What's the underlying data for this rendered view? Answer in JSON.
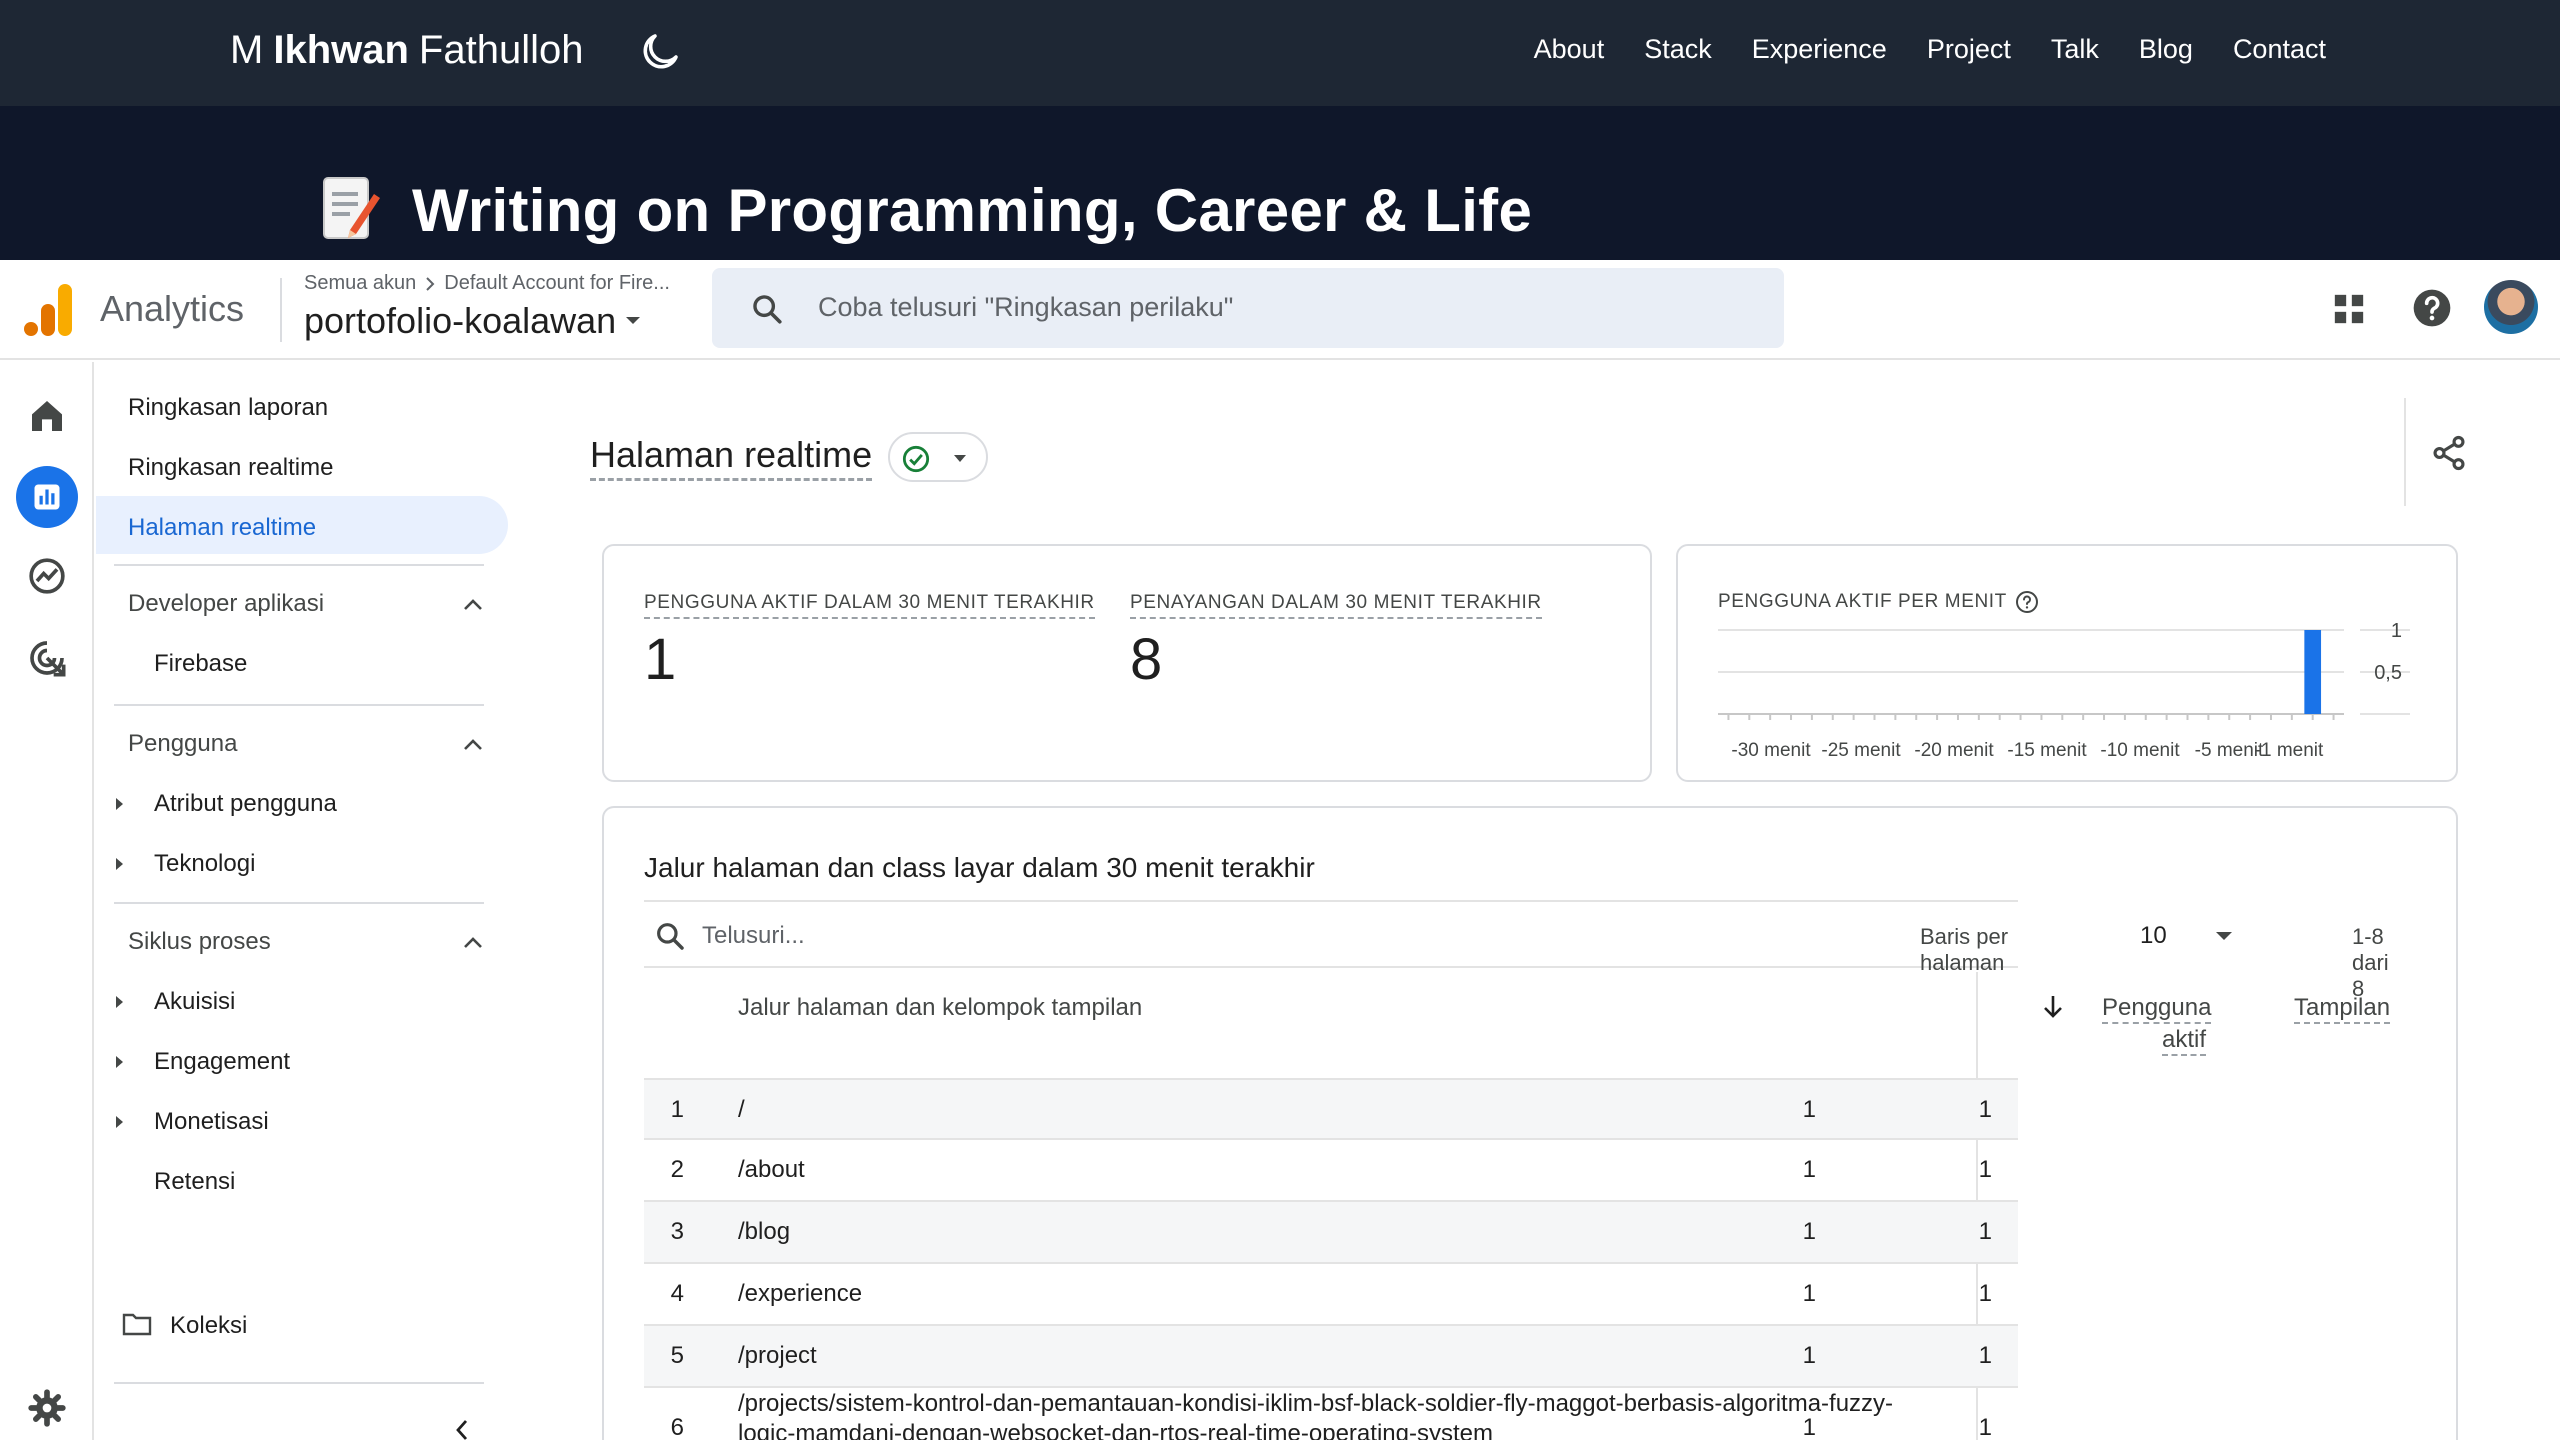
{
  "site": {
    "brand": {
      "first": "M",
      "bold": "Ikhwan",
      "last": "Fathulloh"
    },
    "menu": [
      "About",
      "Stack",
      "Experience",
      "Project",
      "Talk",
      "Blog",
      "Contact"
    ],
    "hero_title": "Writing on Programming, Career & Life"
  },
  "ga": {
    "app_name": "Analytics",
    "breadcrumb_root": "Semua akun",
    "breadcrumb_account": "Default Account for Fire...",
    "property": "portofolio-koalawan",
    "search_placeholder": "Coba telusuri \"Ringkasan perilaku\""
  },
  "nav": {
    "top_items": [
      "Ringkasan laporan",
      "Ringkasan realtime",
      "Halaman realtime"
    ],
    "sections": [
      {
        "title": "Developer aplikasi",
        "items": [
          "Firebase"
        ]
      },
      {
        "title": "Pengguna",
        "items": [
          "Atribut pengguna",
          "Teknologi"
        ]
      },
      {
        "title": "Siklus proses",
        "items": [
          "Akuisisi",
          "Engagement",
          "Monetisasi",
          "Retensi"
        ]
      }
    ],
    "collections": "Koleksi"
  },
  "page": {
    "title": "Halaman realtime",
    "kpi": [
      {
        "label": "PENGGUNA AKTIF DALAM 30 MENIT TERAKHIR",
        "value": "1"
      },
      {
        "label": "PENAYANGAN DALAM 30 MENIT TERAKHIR",
        "value": "8"
      }
    ]
  },
  "chart_data": {
    "type": "bar",
    "title": "PENGGUNA AKTIF PER MENIT",
    "x_tick_labels": [
      "-30 menit",
      "-25 menit",
      "-20 menit",
      "-15 menit",
      "-10 menit",
      "-5 menit",
      "-1 menit"
    ],
    "y_tick_labels": [
      "1",
      "0,5"
    ],
    "ylim": [
      0,
      1
    ],
    "x": [
      -30,
      -29,
      -28,
      -27,
      -26,
      -25,
      -24,
      -23,
      -22,
      -21,
      -20,
      -19,
      -18,
      -17,
      -16,
      -15,
      -14,
      -13,
      -12,
      -11,
      -10,
      -9,
      -8,
      -7,
      -6,
      -5,
      -4,
      -3,
      -2,
      -1
    ],
    "values": [
      0,
      0,
      0,
      0,
      0,
      0,
      0,
      0,
      0,
      0,
      0,
      0,
      0,
      0,
      0,
      0,
      0,
      0,
      0,
      0,
      0,
      0,
      0,
      0,
      0,
      0,
      0,
      0,
      1,
      0
    ],
    "bar_color": "#1a73e8"
  },
  "table": {
    "title": "Jalur halaman dan class layar dalam 30 menit terakhir",
    "search_placeholder": "Telusuri...",
    "rows_per_page_label": "Baris per halaman",
    "rows_per_page": "10",
    "range": "1-8 dari 8",
    "columns": {
      "path": "Jalur halaman dan kelompok tampilan",
      "users_line1": "Pengguna",
      "users_line2": "aktif",
      "views": "Tampilan"
    },
    "rows": [
      {
        "idx": "1",
        "path": "/",
        "users": "1",
        "views": "1"
      },
      {
        "idx": "2",
        "path": "/about",
        "users": "1",
        "views": "1"
      },
      {
        "idx": "3",
        "path": "/blog",
        "users": "1",
        "views": "1"
      },
      {
        "idx": "4",
        "path": "/experience",
        "users": "1",
        "views": "1"
      },
      {
        "idx": "5",
        "path": "/project",
        "users": "1",
        "views": "1"
      },
      {
        "idx": "6",
        "path": "/projects/sistem-kontrol-dan-pemantauan-kondisi-iklim-bsf-black-soldier-fly-maggot-berbasis-algoritma-fuzzy-",
        "path2": "logic-mamdani-dengan-websocket-dan-rtos-real-time-operating-system",
        "users": "1",
        "views": "1"
      }
    ]
  }
}
